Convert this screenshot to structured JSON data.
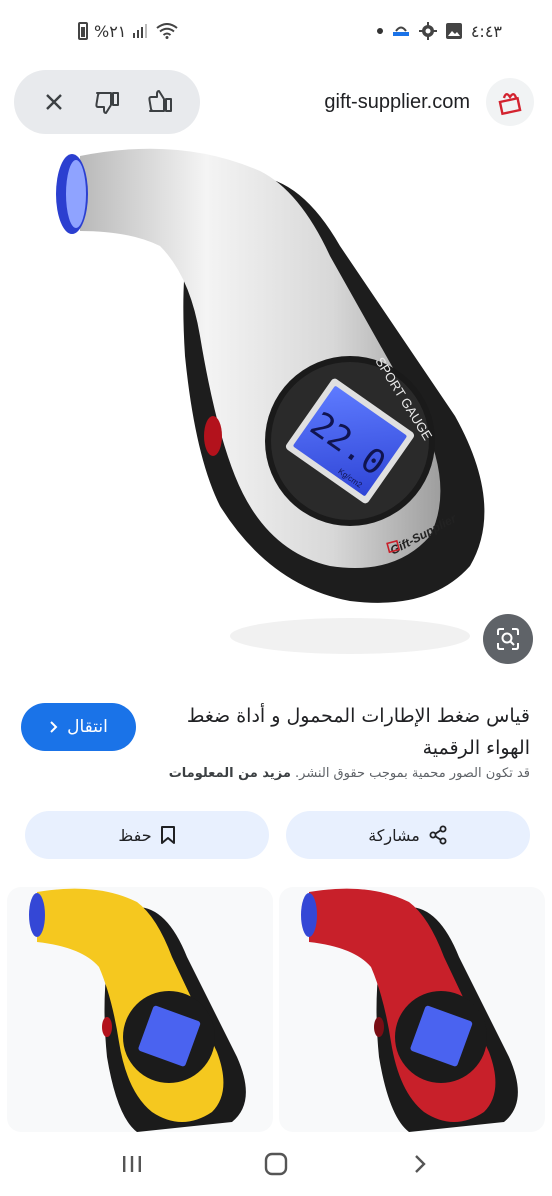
{
  "status_bar": {
    "time": "٤:٤٣",
    "battery": "%٢١"
  },
  "header": {
    "site_name": "gift-supplier.com"
  },
  "main_image": {
    "brand_text": "Gift-Supplier",
    "gauge_label": "SPORT GAUGE",
    "lcd_digits": "22.0",
    "lcd_unit": "Kg/cm2",
    "body_color": "#d9d9d9"
  },
  "result": {
    "title": "قياس ضغط الإطارات المحمول و أداة ضغط الهواء الرقمية",
    "visit_label": "انتقال",
    "copyright_text": "قد تكون الصور محمية بموجب حقوق النشر.",
    "more_info_label": "مزيد من المعلومات"
  },
  "actions": {
    "share_label": "مشاركة",
    "save_label": "حفظ"
  },
  "related": [
    {
      "color": "#f5c81f"
    },
    {
      "color": "#c8202a"
    }
  ],
  "colors": {
    "accent": "#1a73e8",
    "chip_bg": "#e8f0fe",
    "lcd_blue": "#3a58e8"
  }
}
